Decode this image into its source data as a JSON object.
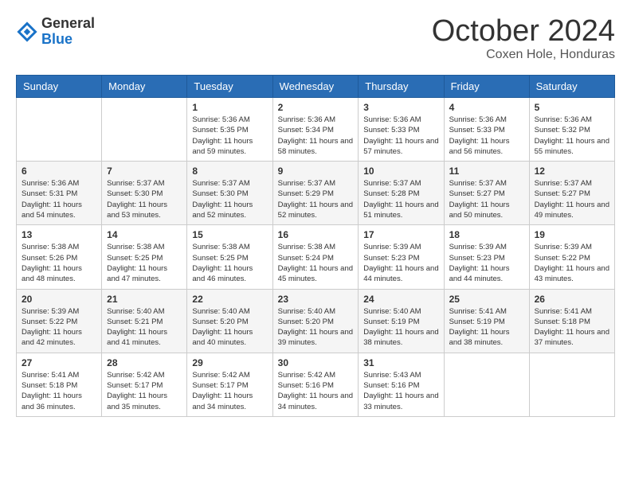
{
  "header": {
    "logo_line1": "General",
    "logo_line2": "Blue",
    "month": "October 2024",
    "location": "Coxen Hole, Honduras"
  },
  "days_of_week": [
    "Sunday",
    "Monday",
    "Tuesday",
    "Wednesday",
    "Thursday",
    "Friday",
    "Saturday"
  ],
  "weeks": [
    [
      {
        "day": "",
        "info": ""
      },
      {
        "day": "",
        "info": ""
      },
      {
        "day": "1",
        "info": "Sunrise: 5:36 AM\nSunset: 5:35 PM\nDaylight: 11 hours and 59 minutes."
      },
      {
        "day": "2",
        "info": "Sunrise: 5:36 AM\nSunset: 5:34 PM\nDaylight: 11 hours and 58 minutes."
      },
      {
        "day": "3",
        "info": "Sunrise: 5:36 AM\nSunset: 5:33 PM\nDaylight: 11 hours and 57 minutes."
      },
      {
        "day": "4",
        "info": "Sunrise: 5:36 AM\nSunset: 5:33 PM\nDaylight: 11 hours and 56 minutes."
      },
      {
        "day": "5",
        "info": "Sunrise: 5:36 AM\nSunset: 5:32 PM\nDaylight: 11 hours and 55 minutes."
      }
    ],
    [
      {
        "day": "6",
        "info": "Sunrise: 5:36 AM\nSunset: 5:31 PM\nDaylight: 11 hours and 54 minutes."
      },
      {
        "day": "7",
        "info": "Sunrise: 5:37 AM\nSunset: 5:30 PM\nDaylight: 11 hours and 53 minutes."
      },
      {
        "day": "8",
        "info": "Sunrise: 5:37 AM\nSunset: 5:30 PM\nDaylight: 11 hours and 52 minutes."
      },
      {
        "day": "9",
        "info": "Sunrise: 5:37 AM\nSunset: 5:29 PM\nDaylight: 11 hours and 52 minutes."
      },
      {
        "day": "10",
        "info": "Sunrise: 5:37 AM\nSunset: 5:28 PM\nDaylight: 11 hours and 51 minutes."
      },
      {
        "day": "11",
        "info": "Sunrise: 5:37 AM\nSunset: 5:27 PM\nDaylight: 11 hours and 50 minutes."
      },
      {
        "day": "12",
        "info": "Sunrise: 5:37 AM\nSunset: 5:27 PM\nDaylight: 11 hours and 49 minutes."
      }
    ],
    [
      {
        "day": "13",
        "info": "Sunrise: 5:38 AM\nSunset: 5:26 PM\nDaylight: 11 hours and 48 minutes."
      },
      {
        "day": "14",
        "info": "Sunrise: 5:38 AM\nSunset: 5:25 PM\nDaylight: 11 hours and 47 minutes."
      },
      {
        "day": "15",
        "info": "Sunrise: 5:38 AM\nSunset: 5:25 PM\nDaylight: 11 hours and 46 minutes."
      },
      {
        "day": "16",
        "info": "Sunrise: 5:38 AM\nSunset: 5:24 PM\nDaylight: 11 hours and 45 minutes."
      },
      {
        "day": "17",
        "info": "Sunrise: 5:39 AM\nSunset: 5:23 PM\nDaylight: 11 hours and 44 minutes."
      },
      {
        "day": "18",
        "info": "Sunrise: 5:39 AM\nSunset: 5:23 PM\nDaylight: 11 hours and 44 minutes."
      },
      {
        "day": "19",
        "info": "Sunrise: 5:39 AM\nSunset: 5:22 PM\nDaylight: 11 hours and 43 minutes."
      }
    ],
    [
      {
        "day": "20",
        "info": "Sunrise: 5:39 AM\nSunset: 5:22 PM\nDaylight: 11 hours and 42 minutes."
      },
      {
        "day": "21",
        "info": "Sunrise: 5:40 AM\nSunset: 5:21 PM\nDaylight: 11 hours and 41 minutes."
      },
      {
        "day": "22",
        "info": "Sunrise: 5:40 AM\nSunset: 5:20 PM\nDaylight: 11 hours and 40 minutes."
      },
      {
        "day": "23",
        "info": "Sunrise: 5:40 AM\nSunset: 5:20 PM\nDaylight: 11 hours and 39 minutes."
      },
      {
        "day": "24",
        "info": "Sunrise: 5:40 AM\nSunset: 5:19 PM\nDaylight: 11 hours and 38 minutes."
      },
      {
        "day": "25",
        "info": "Sunrise: 5:41 AM\nSunset: 5:19 PM\nDaylight: 11 hours and 38 minutes."
      },
      {
        "day": "26",
        "info": "Sunrise: 5:41 AM\nSunset: 5:18 PM\nDaylight: 11 hours and 37 minutes."
      }
    ],
    [
      {
        "day": "27",
        "info": "Sunrise: 5:41 AM\nSunset: 5:18 PM\nDaylight: 11 hours and 36 minutes."
      },
      {
        "day": "28",
        "info": "Sunrise: 5:42 AM\nSunset: 5:17 PM\nDaylight: 11 hours and 35 minutes."
      },
      {
        "day": "29",
        "info": "Sunrise: 5:42 AM\nSunset: 5:17 PM\nDaylight: 11 hours and 34 minutes."
      },
      {
        "day": "30",
        "info": "Sunrise: 5:42 AM\nSunset: 5:16 PM\nDaylight: 11 hours and 34 minutes."
      },
      {
        "day": "31",
        "info": "Sunrise: 5:43 AM\nSunset: 5:16 PM\nDaylight: 11 hours and 33 minutes."
      },
      {
        "day": "",
        "info": ""
      },
      {
        "day": "",
        "info": ""
      }
    ]
  ]
}
